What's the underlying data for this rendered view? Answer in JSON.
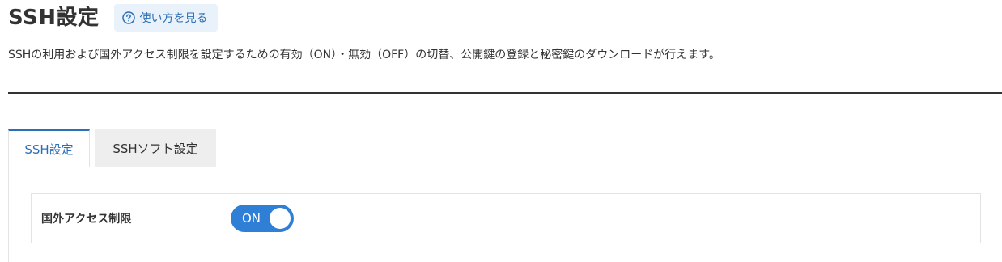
{
  "header": {
    "title": "SSH設定",
    "help_label": "使い方を見る",
    "description": "SSHの利用および国外アクセス制限を設定するための有効（ON）・無効（OFF）の切替、公開鍵の登録と秘密鍵のダウンロードが行えます。"
  },
  "tabs": [
    {
      "label": "SSH設定",
      "active": true
    },
    {
      "label": "SSHソフト設定",
      "active": false
    }
  ],
  "settings": {
    "foreign_access": {
      "label": "国外アクセス制限",
      "toggle_state": "ON"
    }
  },
  "colors": {
    "accent": "#2d6fb6",
    "toggle_on": "#2f7fd6",
    "help_bg": "#e9f2fb"
  },
  "icons": {
    "help": "question-circle-icon"
  }
}
